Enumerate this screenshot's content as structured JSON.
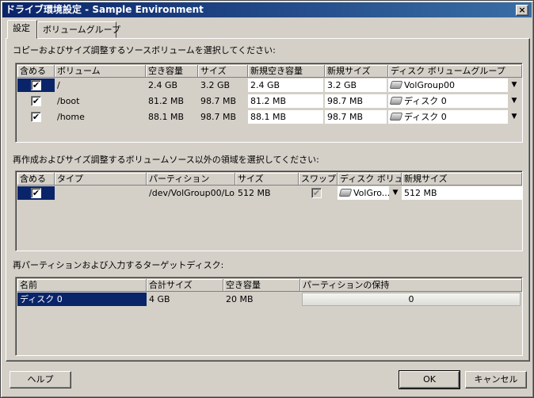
{
  "window": {
    "title": "ドライブ環境設定 - Sample Environment",
    "close_label": "×"
  },
  "tabs": [
    {
      "label": "設定"
    },
    {
      "label": "ボリュームグループ"
    }
  ],
  "section1": {
    "label": "コピーおよびサイズ調整するソースボリュームを選択してください:",
    "headers": [
      "含める",
      "ボリューム",
      "空き容量",
      "サイズ",
      "新規空き容量",
      "新規サイズ",
      "ディスク ボリュームグループ"
    ],
    "rows": [
      {
        "checked": "✔",
        "volume": "/",
        "free": "2.4 GB",
        "size": "3.2 GB",
        "new_free": "2.4 GB",
        "new_size": "3.2 GB",
        "group": "VolGroup00"
      },
      {
        "checked": "✔",
        "volume": "/boot",
        "free": "81.2 MB",
        "size": "98.7 MB",
        "new_free": "81.2 MB",
        "new_size": "98.7 MB",
        "group": "ディスク 0"
      },
      {
        "checked": "✔",
        "volume": "/home",
        "free": "88.1 MB",
        "size": "98.7 MB",
        "new_free": "88.1 MB",
        "new_size": "98.7 MB",
        "group": "ディスク 0"
      }
    ]
  },
  "section2": {
    "label": "再作成およびサイズ調整するボリュームソース以外の領域を選択してください:",
    "headers": [
      "含める",
      "タイプ",
      "パーティション",
      "サイズ",
      "スワップ",
      "ディスク ボリュ...",
      "新規サイズ"
    ],
    "rows": [
      {
        "checked": "✔",
        "type": "",
        "partition": "/dev/VolGroup00/Lo...",
        "size": "512 MB",
        "swap": "✔",
        "disk": "VolGro...",
        "new_size": "512 MB"
      }
    ]
  },
  "section3": {
    "label": "再パーティションおよび入力するターゲットディスク:",
    "headers": [
      "名前",
      "合計サイズ",
      "空き容量",
      "パーティションの保持"
    ],
    "rows": [
      {
        "name": "ディスク 0",
        "total": "4 GB",
        "free": "20 MB",
        "keep": "0"
      }
    ]
  },
  "buttons": {
    "help": "ヘルプ",
    "ok": "OK",
    "cancel": "キャンセル"
  },
  "colors": {
    "titlebar_start": "#0a246a",
    "titlebar_end": "#3a6ea5",
    "selection": "#0a246a",
    "face": "#d4d0c8"
  }
}
